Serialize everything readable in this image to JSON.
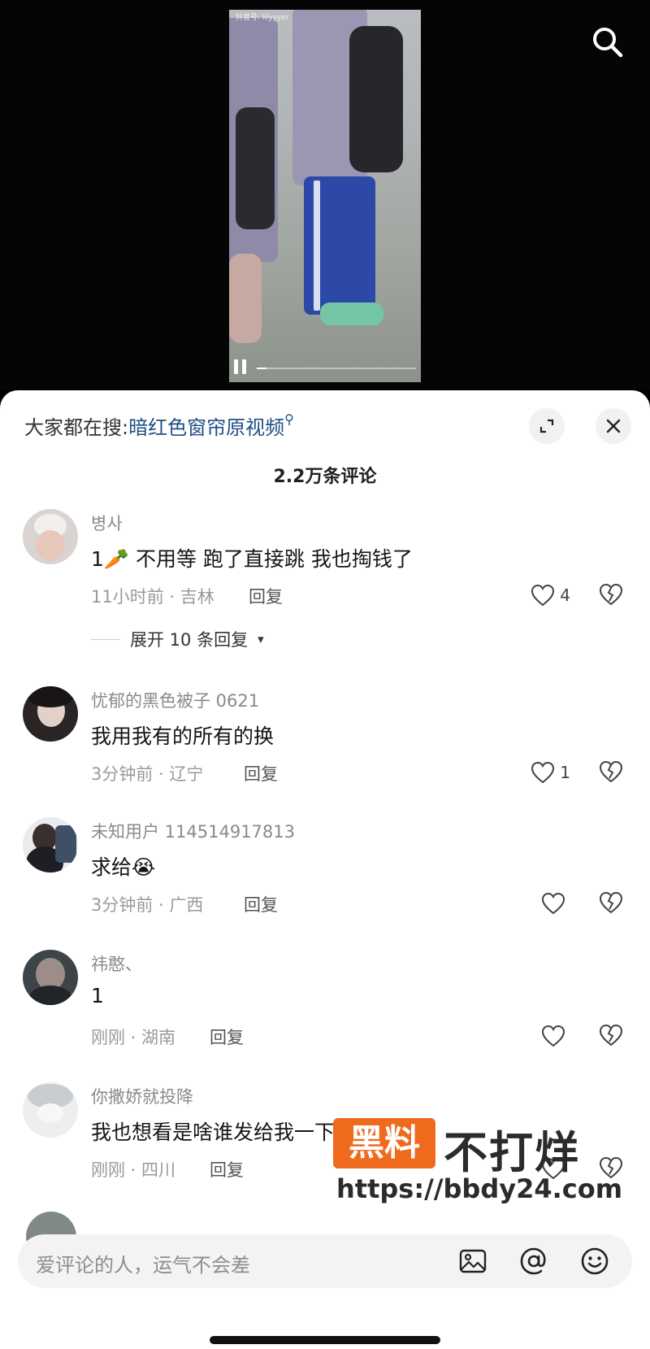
{
  "video": {
    "watermark": "抖音号: lilyyyer",
    "progress": 0.06
  },
  "sheet": {
    "search_prefix": "大家都在搜:",
    "search_term": "暗红色窗帘原视频",
    "comment_count": "2.2万条评论"
  },
  "comments": [
    {
      "name": "병사",
      "text": "1🥕 不用等 跑了直接跳 我也掏钱了",
      "meta": "11小时前 · 吉林",
      "reply_label": "回复",
      "likes": "4",
      "expand": "展开 10 条回复"
    },
    {
      "name": "忧郁的黑色被子 0621",
      "text": "我用我有的所有的换",
      "meta": "3分钟前 · 辽宁",
      "reply_label": "回复",
      "likes": "1"
    },
    {
      "name": "未知用户 114514917813",
      "text": "求给😭",
      "meta": "3分钟前 · 广西",
      "reply_label": "回复",
      "likes": ""
    },
    {
      "name": "祎憨、",
      "text": "1",
      "meta": "刚刚 · 湖南",
      "reply_label": "回复",
      "likes": ""
    },
    {
      "name": "你撒娇就投降",
      "text": "我也想看是啥谁发给我一下嘛",
      "meta": "刚刚 · 四川",
      "reply_label": "回复",
      "likes": ""
    }
  ],
  "watermark": {
    "badge": "黑料",
    "title": "不打烊",
    "url": "https://bbdy24.com"
  },
  "input": {
    "placeholder": "爱评论的人，运气不会差"
  },
  "icons": [
    "search-icon",
    "collapse-icon",
    "close-icon",
    "heart-icon",
    "broken-heart-icon",
    "image-icon",
    "at-icon",
    "emoji-icon",
    "chevron-down-icon",
    "pause-icon"
  ]
}
